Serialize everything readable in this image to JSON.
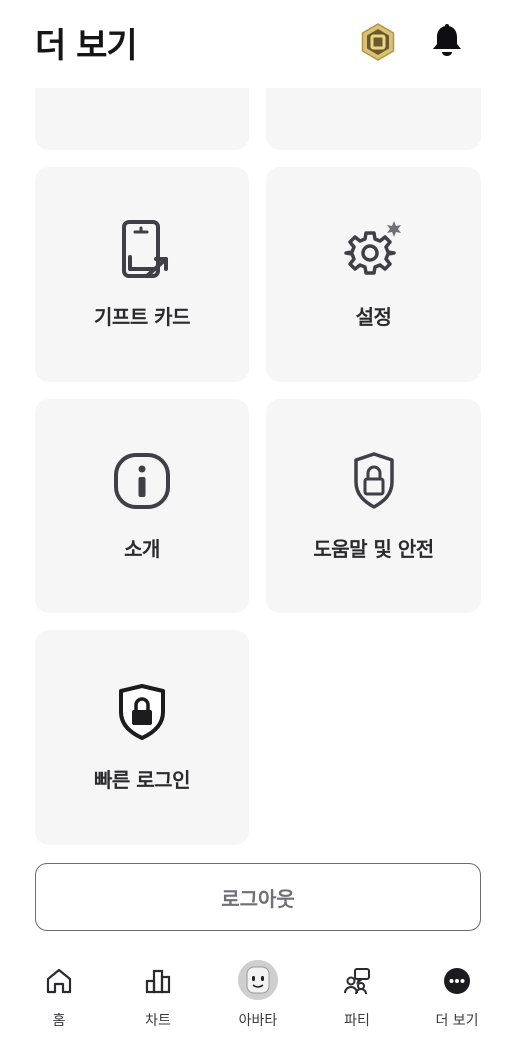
{
  "header": {
    "title": "더 보기",
    "robux_icon": "robux-icon",
    "bell_icon": "bell-icon"
  },
  "tiles": [
    {
      "label": "기프트 카드",
      "icon": "gift-card-icon"
    },
    {
      "label": "설정",
      "icon": "settings-gear-icon"
    },
    {
      "label": "소개",
      "icon": "info-icon"
    },
    {
      "label": "도움말 및 안전",
      "icon": "shield-lock-icon"
    },
    {
      "label": "빠른 로그인",
      "icon": "quick-login-shield-icon"
    }
  ],
  "logout_label": "로그아웃",
  "bottom_nav": [
    {
      "label": "홈",
      "icon": "home-icon"
    },
    {
      "label": "차트",
      "icon": "charts-icon"
    },
    {
      "label": "아바타",
      "icon": "avatar-icon"
    },
    {
      "label": "파티",
      "icon": "party-icon"
    },
    {
      "label": "더 보기",
      "icon": "more-icon"
    }
  ],
  "colors": {
    "tile_bg": "#f6f6f7",
    "icon_gray": "#3f3f44",
    "robux_gold": "#c9a94a"
  }
}
